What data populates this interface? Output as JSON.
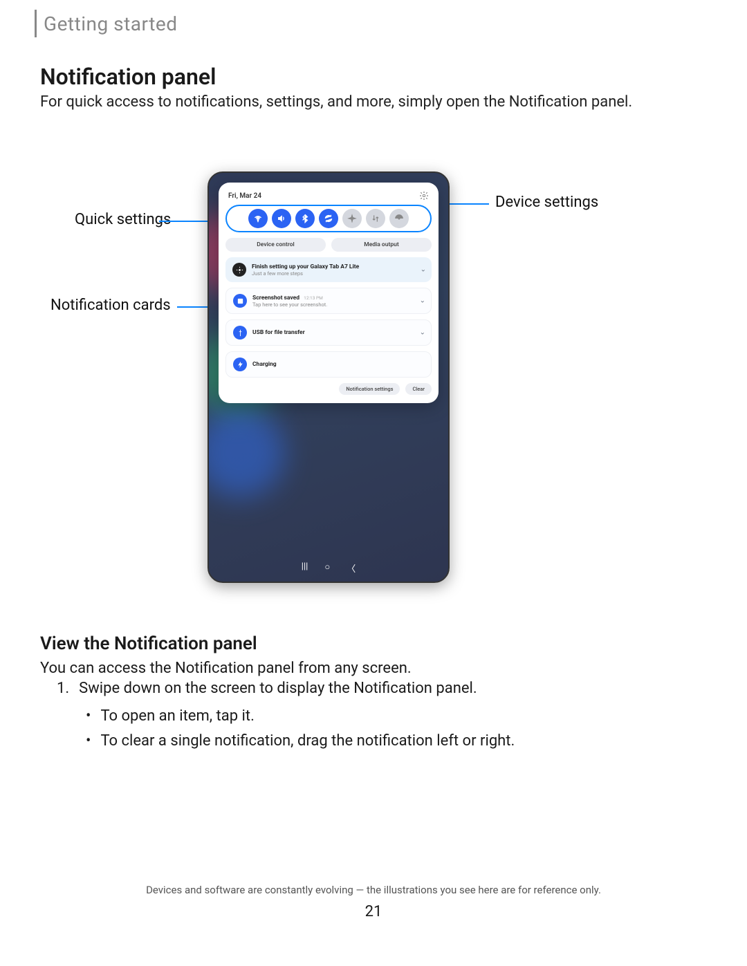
{
  "header": {
    "breadcrumb": "Getting started"
  },
  "title": "Notification panel",
  "intro": "For quick access to notifications, settings, and more, simply open the Notification panel.",
  "callouts": {
    "quick_settings": "Quick settings",
    "device_settings": "Device settings",
    "notification_cards": "Notification cards"
  },
  "device": {
    "date": "Fri, Mar 24",
    "quick_settings": {
      "items": [
        {
          "name": "wifi-icon",
          "on": true
        },
        {
          "name": "volume-icon",
          "on": true
        },
        {
          "name": "bluetooth-icon",
          "on": true
        },
        {
          "name": "autorotate-icon",
          "on": true
        },
        {
          "name": "airplane-icon",
          "on": false
        },
        {
          "name": "data-icon",
          "on": false
        },
        {
          "name": "hotspot-icon",
          "on": false
        }
      ]
    },
    "pills": {
      "device_control": "Device control",
      "media_output": "Media output"
    },
    "cards": [
      {
        "icon": "gear",
        "title": "Finish setting up your Galaxy Tab A7 Lite",
        "sub": "Just a few more steps",
        "stamp": ""
      },
      {
        "icon": "image",
        "title": "Screenshot saved",
        "sub": "Tap here to see your screenshot.",
        "stamp": "12:13 PM"
      },
      {
        "icon": "usb",
        "title": "USB for file transfer",
        "sub": "",
        "stamp": ""
      },
      {
        "icon": "bolt",
        "title": "Charging",
        "sub": "",
        "stamp": ""
      }
    ],
    "footer": {
      "settings": "Notification settings",
      "clear": "Clear"
    }
  },
  "section2": {
    "heading": "View the Notification panel",
    "intro": "You can access the Notification panel from any screen.",
    "step": "Swipe down on the screen to display the Notification panel.",
    "bullets": [
      "To open an item, tap it.",
      "To clear a single notification, drag the notification left or right."
    ]
  },
  "footnote": "Devices and software are constantly evolving — the illustrations you see here are for reference only.",
  "page_number": "21"
}
